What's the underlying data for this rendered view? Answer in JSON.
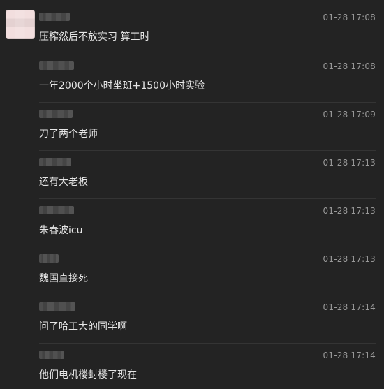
{
  "comments": [
    {
      "time": "01-28 17:08",
      "text": "压榨然后不放实习 算工时"
    },
    {
      "time": "01-28 17:08",
      "text": "一年2000个小时坐班+1500小时实验"
    },
    {
      "time": "01-28 17:09",
      "text": "刀了两个老师"
    },
    {
      "time": "01-28 17:13",
      "text": "还有大老板"
    },
    {
      "time": "01-28 17:13",
      "text": "朱春波icu"
    },
    {
      "time": "01-28 17:13",
      "text": "魏国直接死"
    },
    {
      "time": "01-28 17:14",
      "text": "问了哈工大的同学啊"
    },
    {
      "time": "01-28 17:14",
      "text": "他们电机楼封楼了现在"
    }
  ]
}
